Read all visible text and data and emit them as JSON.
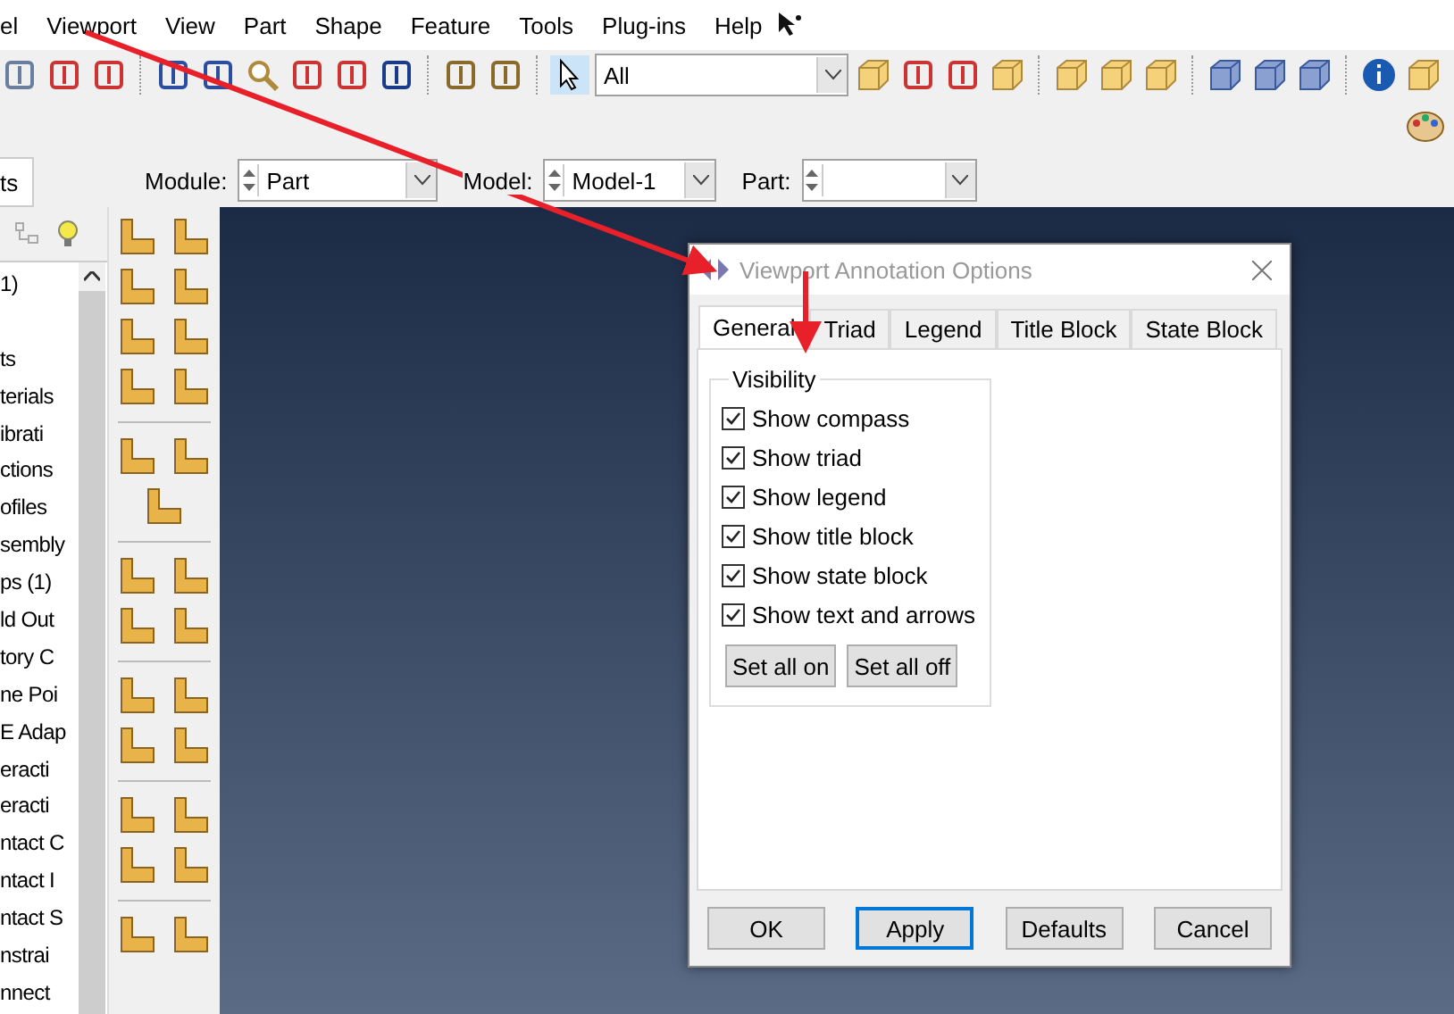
{
  "menu_bar": {
    "items": [
      "el",
      "Viewport",
      "View",
      "Part",
      "Shape",
      "Feature",
      "Tools",
      "Plug-ins",
      "Help"
    ]
  },
  "toolbar": {
    "selection_filter": "All"
  },
  "context_bar": {
    "fields": [
      {
        "label": "Module:",
        "value": "Part"
      },
      {
        "label": "Model:",
        "value": "Model-1"
      },
      {
        "label": "Part:"
      }
    ]
  },
  "model_tree": {
    "tab": "ts",
    "items": [
      "1)",
      "ts",
      "terials",
      "ibrati",
      "ctions",
      "ofiles",
      "sembly",
      "ps (1)",
      "ld Out",
      "tory C",
      "ne Poi",
      "E Adap",
      "eracti",
      "eracti",
      "ntact C",
      "ntact I",
      "ntact S",
      "nstrai",
      "nnect"
    ]
  },
  "dialog": {
    "title": "Viewport Annotation Options",
    "tabs": [
      {
        "label": "General",
        "selected": true
      },
      {
        "label": "Triad",
        "selected": false
      },
      {
        "label": "Legend",
        "selected": false
      },
      {
        "label": "Title Block",
        "selected": false
      },
      {
        "label": "State Block",
        "selected": false
      }
    ],
    "group": "Visibility",
    "options": [
      {
        "label": "Show compass",
        "checked": true
      },
      {
        "label": "Show triad",
        "checked": true
      },
      {
        "label": "Show legend",
        "checked": true
      },
      {
        "label": "Show title block",
        "checked": true
      },
      {
        "label": "Show state block",
        "checked": true
      },
      {
        "label": "Show text and arrows",
        "checked": true
      }
    ],
    "group_buttons": [
      "Set all on",
      "Set all off"
    ],
    "buttons": [
      {
        "label": "OK",
        "focused": false
      },
      {
        "label": "Apply",
        "focused": true
      },
      {
        "label": "Defaults",
        "focused": false
      },
      {
        "label": "Cancel",
        "focused": false
      }
    ]
  }
}
